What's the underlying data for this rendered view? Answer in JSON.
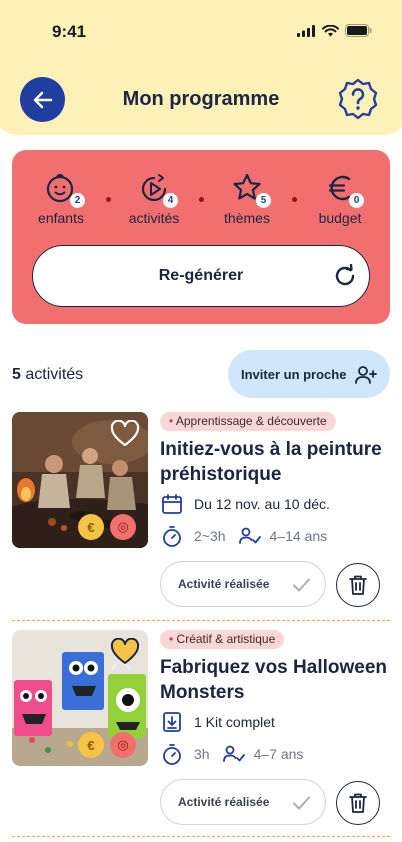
{
  "status_bar": {
    "time": "9:41"
  },
  "header": {
    "title": "Mon programme"
  },
  "summary": {
    "stats": [
      {
        "icon": "child-face-icon",
        "count": "2",
        "label": "enfants"
      },
      {
        "icon": "activity-icon",
        "count": "4",
        "label": "activités"
      },
      {
        "icon": "star-icon",
        "count": "5",
        "label": "thèmes"
      },
      {
        "icon": "euro-icon",
        "count": "0",
        "label": "budget"
      }
    ],
    "regenerate_label": "Re-générer"
  },
  "list": {
    "count_number": "5",
    "count_label": "activités",
    "invite_label": "Inviter un proche"
  },
  "activities": [
    {
      "tag": "Apprentissage & découverte",
      "title": "Initiez-vous à la peinture préhistorique",
      "info_line": "Du 12 nov. au 10 déc.",
      "duration": "2~3h",
      "ages": "4–14 ans",
      "done_label": "Activité réalisée",
      "favorite": false
    },
    {
      "tag": "Créatif & artistique",
      "title": "Fabriquez vos Halloween Monsters",
      "info_line": "1 Kit complet",
      "duration": "3h",
      "ages": "4–7 ans",
      "done_label": "Activité réalisée",
      "favorite": true
    }
  ],
  "colors": {
    "header_bg": "#fdf1b8",
    "summary_bg": "#f26f6f",
    "primary": "#1f3ea0",
    "invite_bg": "#cfe6fb",
    "tag_bg": "#fbd6d6",
    "favorite": "#f6c445"
  }
}
